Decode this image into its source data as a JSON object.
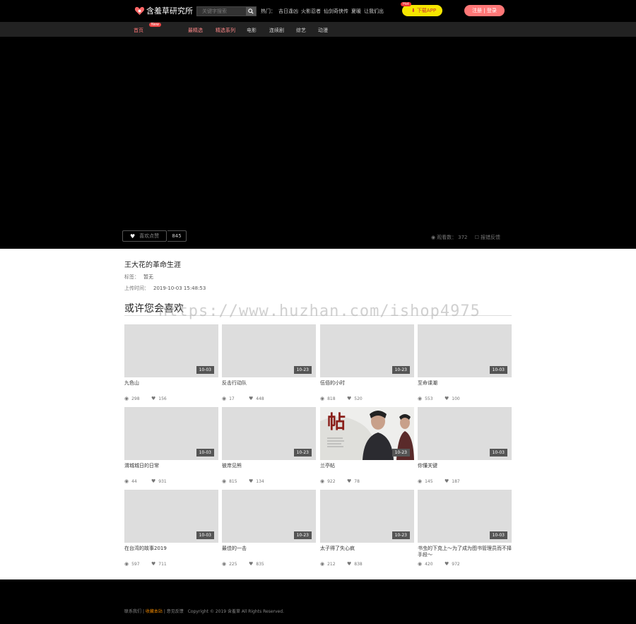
{
  "header": {
    "logo_text": "含羞草研究所",
    "search_placeholder": "关键字搜索",
    "hot_label": "热门：",
    "hot_links": [
      "吉日逢凶",
      "火影忍者",
      "仙剑奇侠传",
      "夏暖",
      "让我们出"
    ],
    "download_label": "下载APP",
    "hot_badge": "Hot",
    "login_label": "注册 | 登录"
  },
  "nav": {
    "home": "首页",
    "new_badge": "New",
    "items": [
      "最精选",
      "精选系列",
      "电影",
      "连续剧",
      "综艺",
      "动漫"
    ]
  },
  "player": {
    "fav_label": "喜欢点赞",
    "fav_count": "845",
    "views_label": "观看数：",
    "views_value": "372",
    "feedback_label": "报错反馈"
  },
  "video": {
    "title": "王大花的革命生涯",
    "tag_label": "标签：",
    "tag_value": "暂无",
    "upload_label": "上传时间：",
    "upload_value": "2019-10-03 15:48:53"
  },
  "recommend": {
    "title": "或许您会喜欢",
    "watermark": "https://www.huzhan.com/ishop4975",
    "cards": [
      {
        "title": "九色山",
        "date": "10-03",
        "views": "298",
        "likes": "156"
      },
      {
        "title": "反击行动队",
        "date": "10-23",
        "views": "17",
        "likes": "448"
      },
      {
        "title": "伍佰的小时",
        "date": "10-23",
        "views": "818",
        "likes": "520"
      },
      {
        "title": "至命谍潮",
        "date": "10-03",
        "views": "553",
        "likes": "100"
      },
      {
        "title": "渭城城日的日常",
        "date": "10-03",
        "views": "44",
        "likes": "931"
      },
      {
        "title": "彼岸见熊",
        "date": "10-23",
        "views": "815",
        "likes": "134"
      },
      {
        "title": "兰亭帖",
        "date": "10-23",
        "views": "922",
        "likes": "78"
      },
      {
        "title": "你懂关键",
        "date": "10-03",
        "views": "145",
        "likes": "187"
      },
      {
        "title": "在台湾的故事2019",
        "date": "10-03",
        "views": "597",
        "likes": "711"
      },
      {
        "title": "最佳的一击",
        "date": "10-23",
        "views": "225",
        "likes": "835"
      },
      {
        "title": "太子得了失心疯",
        "date": "10-23",
        "views": "212",
        "likes": "838"
      },
      {
        "title": "书虫的下克上～为了成为图书管理员而不择手段～",
        "date": "10-03",
        "views": "420",
        "likes": "972"
      }
    ]
  },
  "footer": {
    "contact": "联系我们",
    "sep1": "|",
    "favorite": "收藏本站",
    "sep2": "|",
    "feedback": "意见反馈",
    "copyright": "Copyright © 2019 含羞草 All Rights Reserved."
  }
}
